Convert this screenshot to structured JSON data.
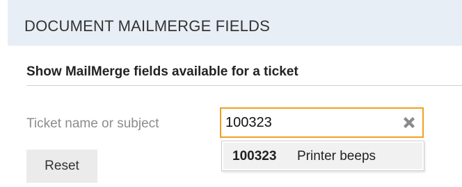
{
  "header": {
    "title": "DOCUMENT MAILMERGE FIELDS"
  },
  "section": {
    "subtitle": "Show MailMerge fields available for a ticket"
  },
  "search": {
    "label": "Ticket name or subject",
    "value": "100323",
    "clear_icon": "clear-x-icon"
  },
  "suggestions": [
    {
      "id": "100323",
      "text": "Printer beeps"
    }
  ],
  "actions": {
    "reset_label": "Reset"
  },
  "colors": {
    "header_background": "#e8eef6",
    "input_focus_border": "#f0a020",
    "suggestion_highlight": "#f1f1f1",
    "button_background": "#ebebeb"
  }
}
